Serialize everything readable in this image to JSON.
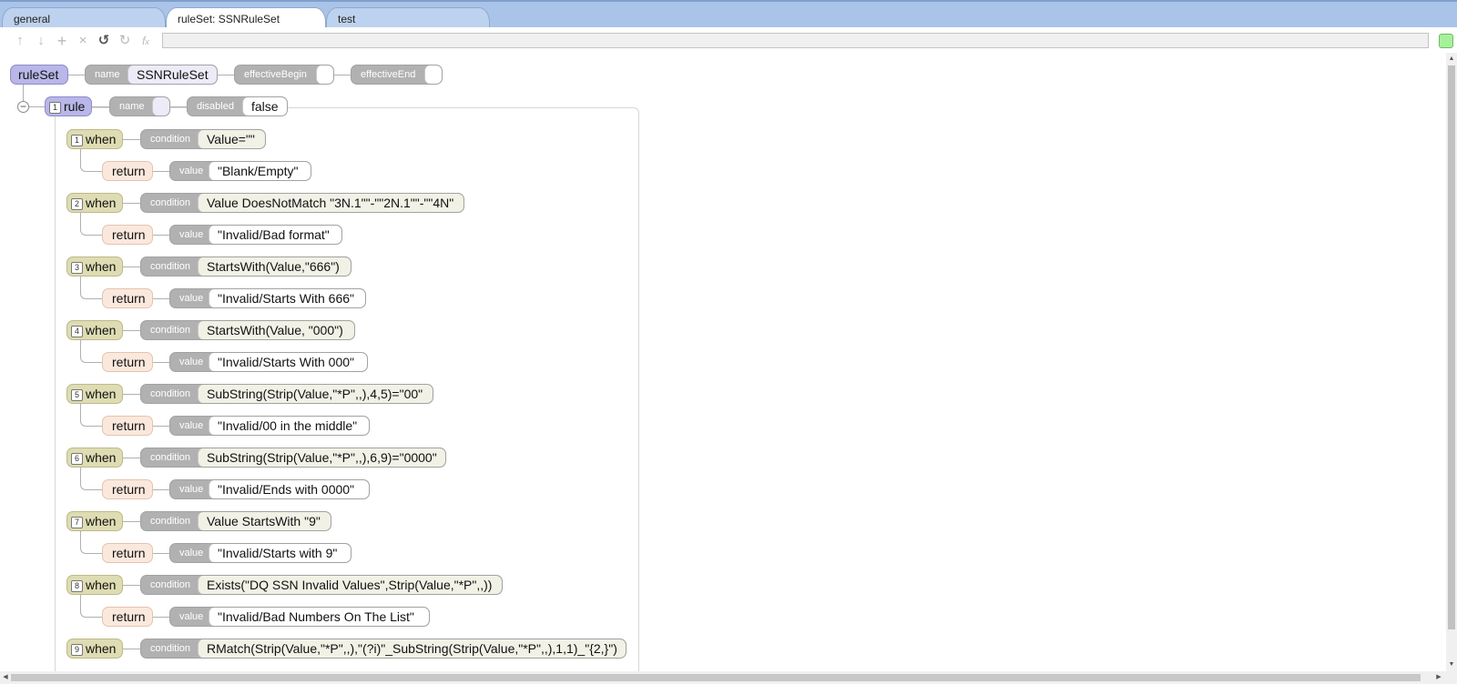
{
  "tabs": [
    {
      "label": "general"
    },
    {
      "label": "ruleSet: SSNRuleSet"
    },
    {
      "label": "test"
    }
  ],
  "toolbar": {
    "icons": [
      "arrow-up-icon",
      "arrow-down-icon",
      "add-icon",
      "delete-icon",
      "undo-icon",
      "redo-icon",
      "function-icon"
    ]
  },
  "ruleset": {
    "label": "ruleSet",
    "name_label": "name",
    "name_value": "SSNRuleSet",
    "effective_begin_label": "effectiveBegin",
    "effective_begin_value": "",
    "effective_end_label": "effectiveEnd",
    "effective_end_value": ""
  },
  "rule": {
    "index": "1",
    "label": "rule",
    "name_label": "name",
    "name_value": "",
    "disabled_label": "disabled",
    "disabled_value": "false"
  },
  "when_label": "when",
  "condition_label": "condition",
  "return_label": "return",
  "value_label": "value",
  "whens": [
    {
      "index": "1",
      "condition": "Value=\"\"",
      "return_value": "\"Blank/Empty\""
    },
    {
      "index": "2",
      "condition": "Value DoesNotMatch \"3N.1\"\"-\"\"2N.1\"\"-\"\"4N\"",
      "return_value": "\"Invalid/Bad format\""
    },
    {
      "index": "3",
      "condition": "StartsWith(Value,\"666\")",
      "return_value": "\"Invalid/Starts With 666\""
    },
    {
      "index": "4",
      "condition": "StartsWith(Value, \"000\")",
      "return_value": "\"Invalid/Starts With 000\""
    },
    {
      "index": "5",
      "condition": "SubString(Strip(Value,\"*P\",,),4,5)=\"00\"",
      "return_value": "\"Invalid/00 in the middle\""
    },
    {
      "index": "6",
      "condition": "SubString(Strip(Value,\"*P\",,),6,9)=\"0000\"",
      "return_value": "\"Invalid/Ends with 0000\""
    },
    {
      "index": "7",
      "condition": "Value StartsWith \"9\"",
      "return_value": "\"Invalid/Starts with 9\""
    },
    {
      "index": "8",
      "condition": "Exists(\"DQ SSN Invalid Values\",Strip(Value,\"*P\",,))",
      "return_value": "\"Invalid/Bad Numbers On The List\""
    },
    {
      "index": "9",
      "condition": "RMatch(Strip(Value,\"*P\",,),\"(?i)\"_SubString(Strip(Value,\"*P\",,),1,1)_\"{2,}\")",
      "return_value": ""
    }
  ],
  "colors": {
    "tabbar": "#a9c4e8",
    "ruleset_node": "#b9b6e8",
    "when_node": "#dedcb2",
    "return_node": "#fbe8dd",
    "property_pill": "#b1b1b1",
    "status_ok": "#a6f09b"
  }
}
